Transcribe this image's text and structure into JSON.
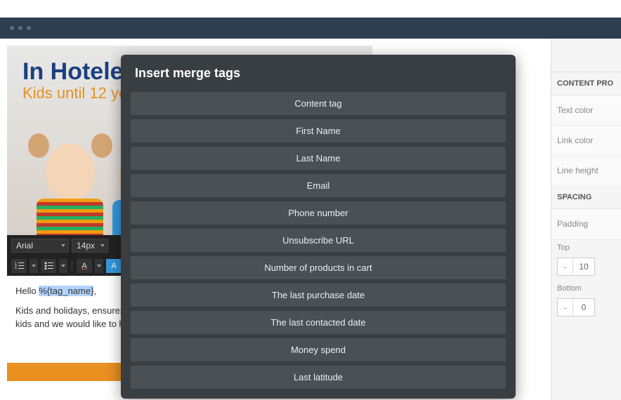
{
  "hero": {
    "title1": "In Hotele",
    "title2": "Kids until 12 ye"
  },
  "toolbar": {
    "font": "Arial",
    "size": "14px"
  },
  "editor": {
    "greeting_prefix": "Hello ",
    "tag": "%{tag_name}",
    "greeting_suffix": ",",
    "para1": "Kids and holidays, ensures",
    "para2": "kids and we would like to he"
  },
  "modal": {
    "title": "Insert merge tags",
    "items": [
      "Content tag",
      "First Name",
      "Last Name",
      "Email",
      "Phone number",
      "Unsubscribe URL",
      "Number of products in cart",
      "The last purchase date",
      "The last contacted date",
      "Money spend",
      "Last latitude"
    ]
  },
  "sidebar": {
    "section1": "CONTENT PRO",
    "prop1": "Text color",
    "prop2": "Link color",
    "prop3": "Line height",
    "section2": "SPACING",
    "prop4": "Padding",
    "label_top": "Top",
    "val_top": "10",
    "label_bottom": "Bottom",
    "val_bottom": "0"
  }
}
